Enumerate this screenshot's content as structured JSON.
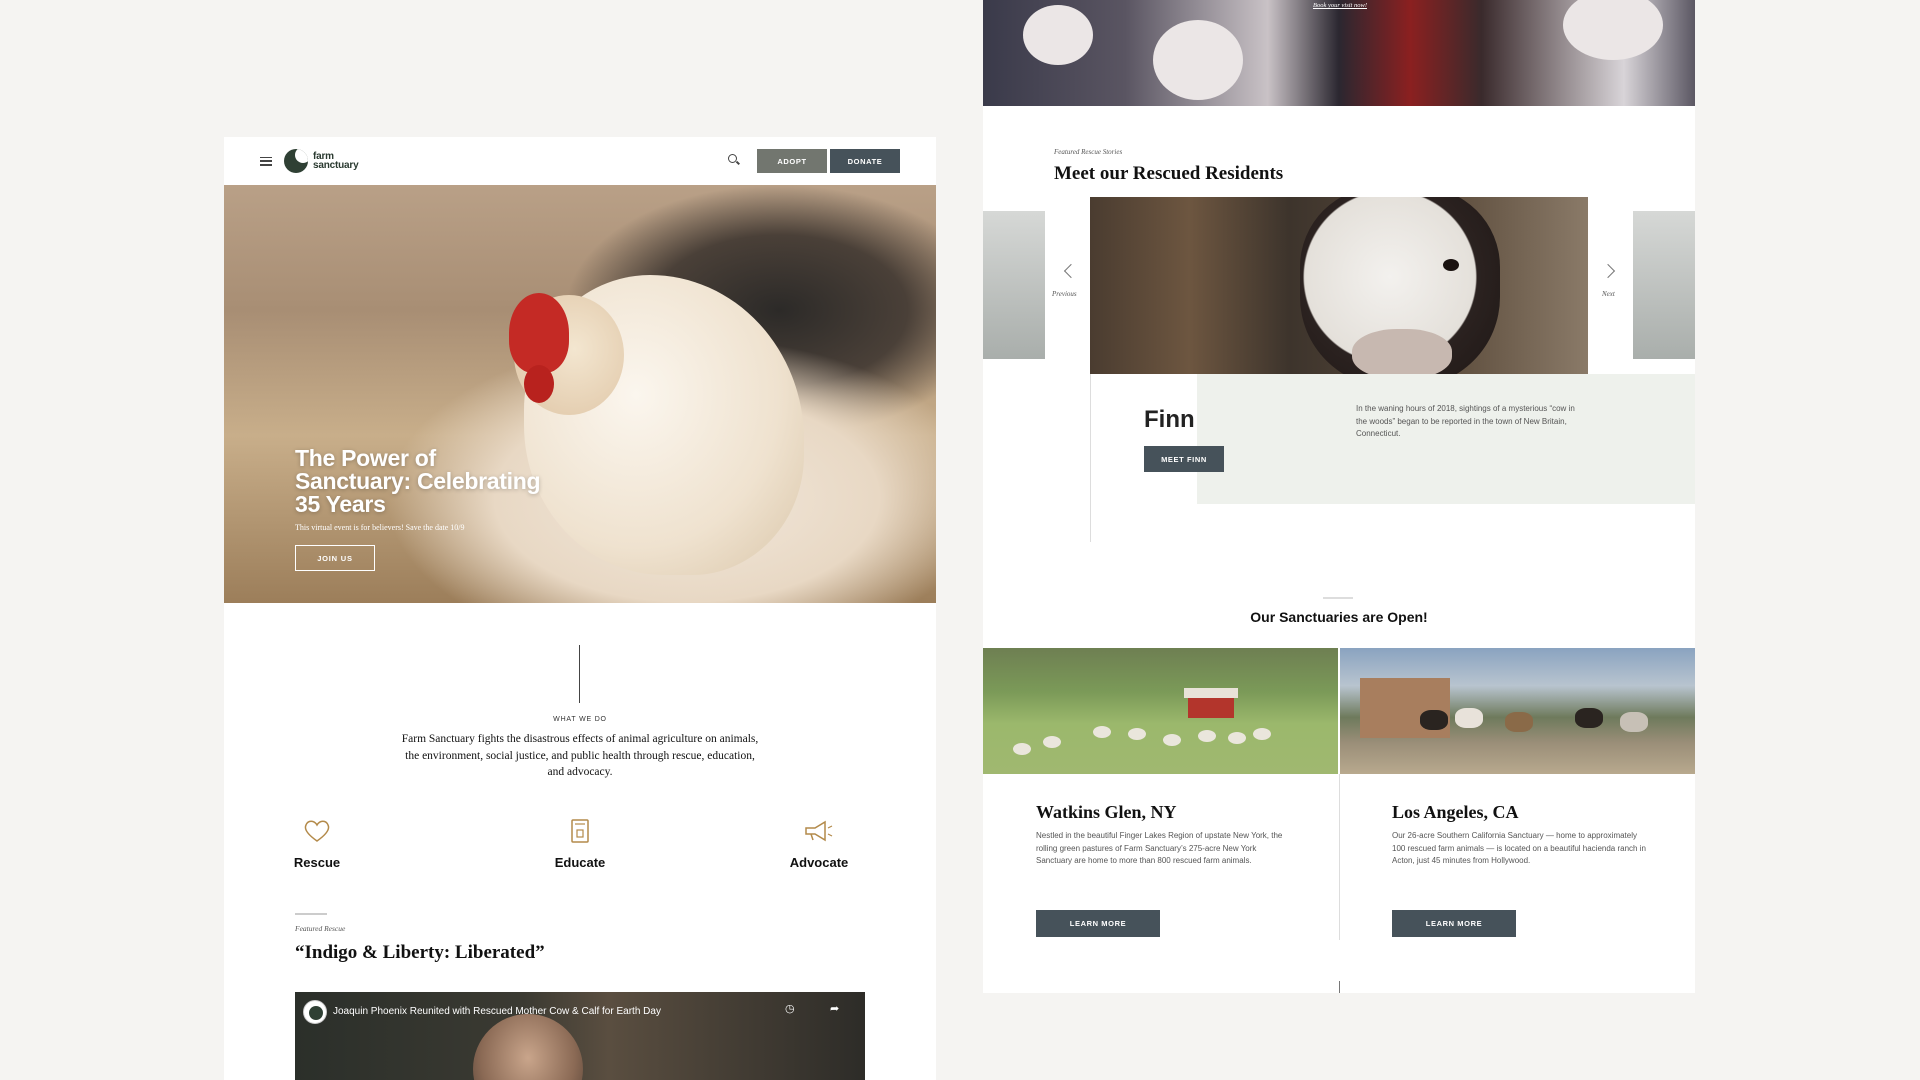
{
  "colors": {
    "page_bg": "#f5f4f2",
    "button_dark": "#46525a",
    "button_gray": "#72766f",
    "logo_green": "#2f4034",
    "slide_bg": "#eef1ec"
  },
  "left": {
    "header": {
      "logo_line1": "farm",
      "logo_line2": "sanctuary",
      "adopt": "ADOPT",
      "donate": "DONATE",
      "menu_icon": "hamburger-icon",
      "search_icon": "search-icon"
    },
    "hero": {
      "title": "The Power of Sanctuary: Celebrating 35 Years",
      "subtitle": "This virtual event is for believers! Save the date 10/9",
      "cta": "JOIN US"
    },
    "what_we_do": {
      "label": "WHAT WE DO",
      "text": "Farm Sanctuary fights the disastrous effects of animal agriculture on animals, the environment, social justice, and public health through rescue, education, and advocacy."
    },
    "pillars": [
      {
        "label": "Rescue",
        "icon": "heart-icon"
      },
      {
        "label": "Educate",
        "icon": "book-icon"
      },
      {
        "label": "Advocate",
        "icon": "megaphone-icon"
      }
    ],
    "featured": {
      "kicker": "Featured Rescue",
      "title": "“Indigo & Liberty: Liberated”"
    },
    "video": {
      "title": "Joaquin Phoenix Reunited with Rescued Mother Cow & Calf for Earth Day"
    }
  },
  "right": {
    "banner_link": "Book your visit now!",
    "residents": {
      "kicker": "Featured Rescue Stories",
      "title": "Meet our Rescued Residents",
      "prev": "Previous",
      "next": "Next",
      "name": "Finn",
      "cta": "MEET FINN",
      "desc": "In the waning hours of 2018, sightings of a mysterious “cow in the woods” began to be reported in the town of New Britain, Connecticut."
    },
    "sanctuaries": {
      "title": "Our Sanctuaries are Open!",
      "locations": [
        {
          "name": "Watkins Glen, NY",
          "desc": "Nestled in the beautiful Finger Lakes Region of upstate New York, the rolling green pastures of Farm Sanctuary’s 275-acre New York Sanctuary are home to more than 800 rescued farm animals.",
          "cta": "LEARN MORE"
        },
        {
          "name": "Los Angeles, CA",
          "desc": "Our 26-acre Southern California Sanctuary — home to approximately 100 rescued farm animals — is located on a beautiful hacienda ranch in Acton, just 45 minutes from Hollywood.",
          "cta": "LEARN MORE"
        }
      ]
    }
  }
}
